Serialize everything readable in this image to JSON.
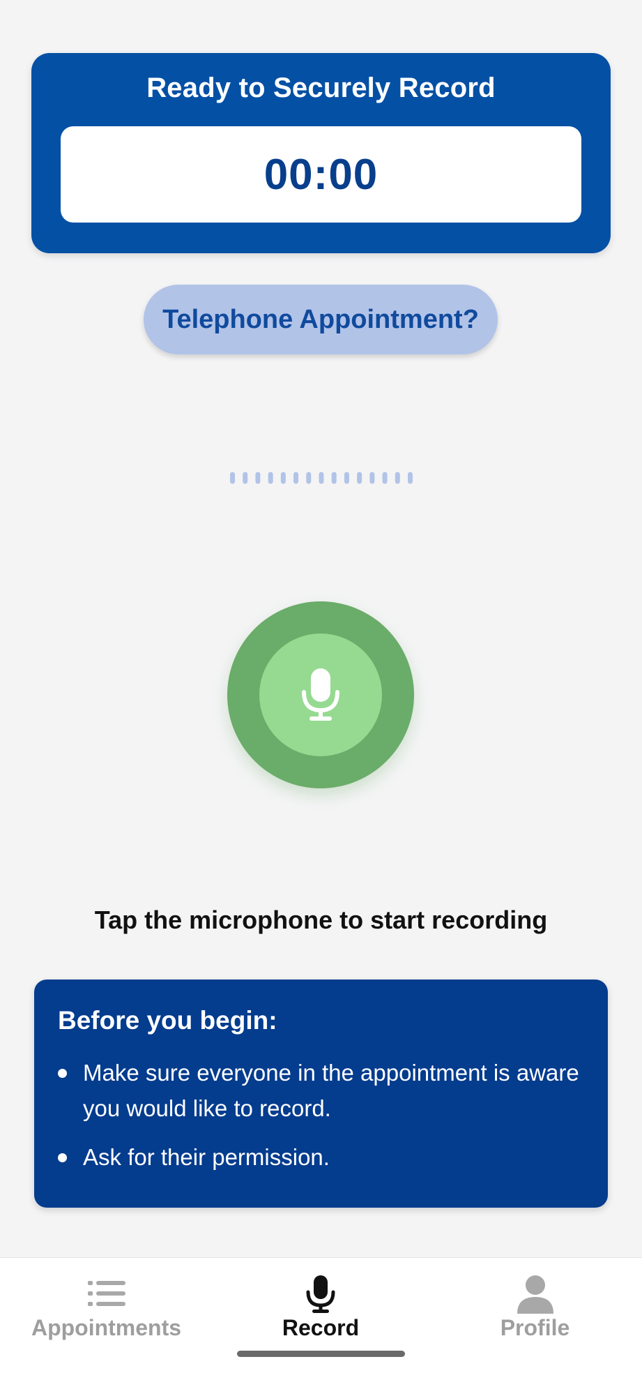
{
  "status_card": {
    "title": "Ready to Securely Record",
    "timer": "00:00"
  },
  "telephone_button": {
    "label": "Telephone Appointment?"
  },
  "waveform": {
    "bar_count": 15,
    "color": "#b2c3e8"
  },
  "mic_button": {
    "icon": "microphone-icon",
    "outer_color": "#6aac69",
    "inner_color": "#96da91"
  },
  "hint": "Tap the microphone to start recording",
  "info_card": {
    "title": "Before you begin:",
    "items": [
      "Make sure everyone in the appointment is aware you would like to record.",
      "Ask for their permission."
    ]
  },
  "tabbar": {
    "tabs": [
      {
        "label": "Appointments",
        "icon": "list-icon",
        "active": false
      },
      {
        "label": "Record",
        "icon": "microphone-icon",
        "active": true
      },
      {
        "label": "Profile",
        "icon": "person-icon",
        "active": false
      }
    ]
  },
  "colors": {
    "primary_blue": "#0450a5",
    "dark_blue": "#043c8e",
    "timer_blue": "#083f8c",
    "pill_blue": "#b2c3e8",
    "background": "#f4f4f5"
  }
}
